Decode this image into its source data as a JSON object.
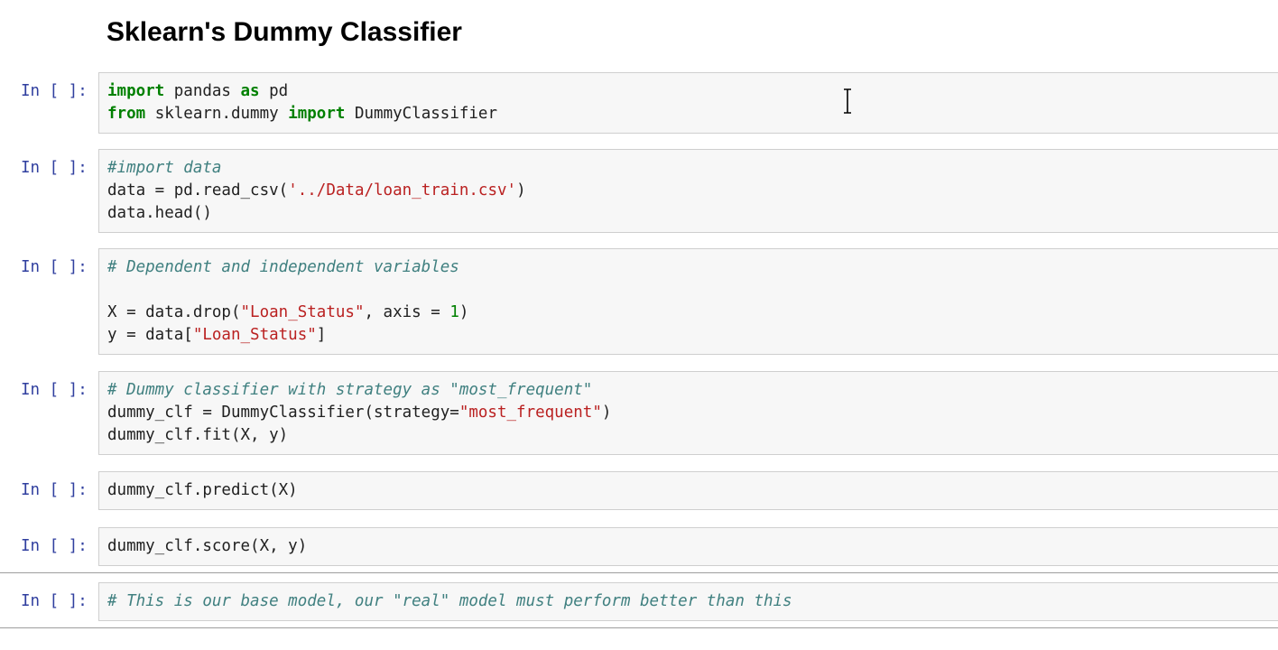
{
  "notebook": {
    "title": "Sklearn's Dummy Classifier",
    "prompt_label": "In [ ]:",
    "cells": [
      {
        "lines": [
          [
            {
              "t": "import",
              "c": "kw"
            },
            {
              "t": " pandas "
            },
            {
              "t": "as",
              "c": "kw"
            },
            {
              "t": " pd"
            }
          ],
          [
            {
              "t": "from",
              "c": "kw"
            },
            {
              "t": " sklearn.dummy "
            },
            {
              "t": "import",
              "c": "kw"
            },
            {
              "t": " DummyClassifier"
            }
          ]
        ]
      },
      {
        "lines": [
          [
            {
              "t": "#import data",
              "c": "cm"
            }
          ],
          [
            {
              "t": "data = pd.read_csv("
            },
            {
              "t": "'../Data/loan_train.csv'",
              "c": "st"
            },
            {
              "t": ")"
            }
          ],
          [
            {
              "t": "data.head()"
            }
          ]
        ]
      },
      {
        "lines": [
          [
            {
              "t": "# Dependent and independent variables",
              "c": "cm"
            }
          ],
          [],
          [
            {
              "t": "X = data.drop("
            },
            {
              "t": "\"Loan_Status\"",
              "c": "st"
            },
            {
              "t": ", axis = "
            },
            {
              "t": "1",
              "c": "nu"
            },
            {
              "t": ")"
            }
          ],
          [
            {
              "t": "y = data["
            },
            {
              "t": "\"Loan_Status\"",
              "c": "st"
            },
            {
              "t": "]"
            }
          ]
        ]
      },
      {
        "lines": [
          [
            {
              "t": "# Dummy classifier with strategy as \"most_frequent\"",
              "c": "cm"
            }
          ],
          [
            {
              "t": "dummy_clf = DummyClassifier(strategy="
            },
            {
              "t": "\"most_frequent\"",
              "c": "st"
            },
            {
              "t": ")"
            }
          ],
          [
            {
              "t": "dummy_clf.fit(X, y)"
            }
          ]
        ]
      },
      {
        "lines": [
          [
            {
              "t": "dummy_clf.predict(X)"
            }
          ]
        ]
      },
      {
        "lines": [
          [
            {
              "t": "dummy_clf.score(X, y)"
            }
          ]
        ]
      },
      {
        "lines": [
          [
            {
              "t": "# This is our base model, our \"real\" model must perform better than this",
              "c": "cm"
            }
          ]
        ]
      }
    ]
  },
  "icons": {
    "cursor": "text-cursor-icon"
  },
  "colors": {
    "prompt": "#303f9f",
    "keyword": "#008000",
    "comment": "#408080",
    "string": "#ba2121",
    "cell_background": "#f7f7f7",
    "cell_border": "#cfcfcf"
  }
}
